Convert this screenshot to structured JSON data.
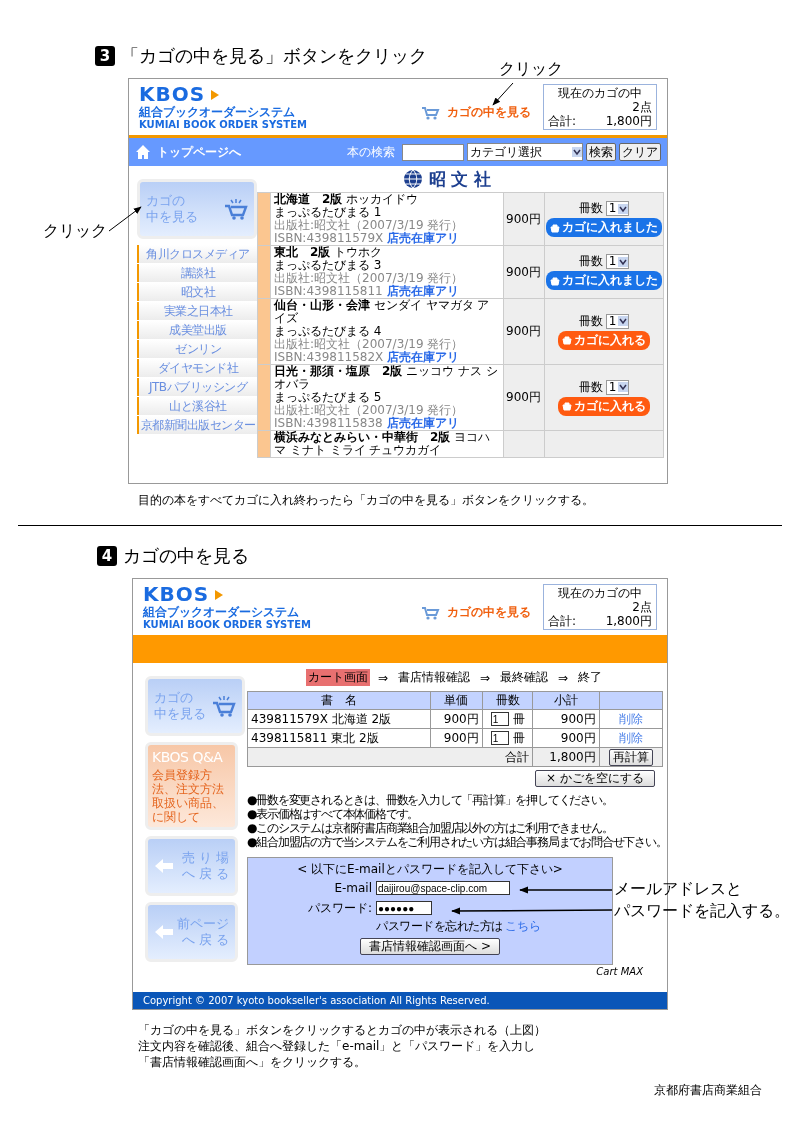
{
  "step3": {
    "number": "3",
    "title": "「カゴの中を見る」ボタンをクリック",
    "callouts": [
      "クリック",
      "クリック"
    ],
    "screen": {
      "header": {
        "logo": "KBOS",
        "logo_sub": "組合ブックオーダーシステム",
        "logo_en": "KUMIAI BOOK ORDER SYSTEM",
        "cart_link": "カゴの中を見る",
        "summary_title": "現在のカゴの中",
        "count": "2点",
        "total_label": "合計:",
        "total": "1,800円"
      },
      "nav": {
        "home": "トップページへ",
        "search_label": "本の検索",
        "category": "カテゴリ選択",
        "search_button": "検索",
        "clear_button": "クリア"
      },
      "sidebar": {
        "cart_button": [
          "カゴの",
          "中を見る"
        ],
        "publishers": [
          "角川クロスメディア",
          "講談社",
          "昭文社",
          "実業之日本社",
          "成美堂出版",
          "ゼンリン",
          "ダイヤモンド社",
          "JTBパブリッシング",
          "山と溪谷社",
          "京都新聞出版センター"
        ]
      },
      "publisher_name": "昭 文 社",
      "books": [
        {
          "title": "北海道　2版",
          "reading": "ホッカイドウ",
          "series": "まっぷるたびまる 1",
          "publisher": "出版社:昭文社（2007/3/19 発行）",
          "isbn": "ISBN:439811579X",
          "stock": "店売在庫アリ",
          "price": "900円",
          "qty_label": "冊数",
          "qty": "1",
          "in_cart": true,
          "button": "カゴに入れました"
        },
        {
          "title": "東北　2版",
          "reading": "トウホク",
          "series": "まっぷるたびまる 3",
          "publisher": "出版社:昭文社（2007/3/19 発行）",
          "isbn": "ISBN:4398115811",
          "stock": "店売在庫アリ",
          "price": "900円",
          "qty_label": "冊数",
          "qty": "1",
          "in_cart": true,
          "button": "カゴに入れました"
        },
        {
          "title": "仙台・山形・会津",
          "reading": "センダイ ヤマガタ アイズ",
          "series": "まっぷるたびまる 4",
          "publisher": "出版社:昭文社（2007/3/19 発行）",
          "isbn": "ISBN:439811582X",
          "stock": "店売在庫アリ",
          "price": "900円",
          "qty_label": "冊数",
          "qty": "1",
          "in_cart": false,
          "button": "カゴに入れる"
        },
        {
          "title": "日光・那須・塩原　2版",
          "reading": "ニッコウ ナス シオバラ",
          "series": "まっぷるたびまる 5",
          "publisher": "出版社:昭文社（2007/3/19 発行）",
          "isbn": "ISBN:4398115838",
          "stock": "店売在庫アリ",
          "price": "900円",
          "qty_label": "冊数",
          "qty": "1",
          "in_cart": false,
          "button": "カゴに入れる"
        },
        {
          "title": "横浜みなとみらい・中華街　2版",
          "reading": "ヨコハマ ミナト ミライ チュウカガイ"
        }
      ]
    },
    "caption": "目的の本をすべてカゴに入れ終わったら「カゴの中を見る」ボタンをクリックする。"
  },
  "step4": {
    "number": "4",
    "title": "カゴの中を見る",
    "callout": [
      "メールアドレスと",
      "パスワードを記入する。"
    ],
    "screen": {
      "header": {
        "logo": "KBOS",
        "logo_sub": "組合ブックオーダーシステム",
        "logo_en": "KUMIAI BOOK ORDER SYSTEM",
        "cart_link": "カゴの中を見る",
        "summary_title": "現在のカゴの中",
        "count": "2点",
        "total_label": "合計:",
        "total": "1,800円"
      },
      "sidebar": [
        {
          "kind": "cart",
          "lines": [
            "カゴの",
            "中を見る"
          ]
        },
        {
          "kind": "qa",
          "title": "KBOS Q&A",
          "lines": [
            "会員登録方法、注文方法",
            "取扱い商品、に関して"
          ]
        },
        {
          "kind": "back",
          "lines": [
            "売 り 場",
            "へ 戻 る"
          ]
        },
        {
          "kind": "back",
          "lines": [
            "前ページ",
            "へ 戻 る"
          ]
        }
      ],
      "steps": [
        {
          "label": "カート画面",
          "selected": true,
          "arrow": "⇒"
        },
        {
          "label": "書店情報確認",
          "selected": false,
          "arrow": "⇒"
        },
        {
          "label": "最終確認",
          "selected": false,
          "arrow": "⇒"
        },
        {
          "label": "終了",
          "selected": false
        }
      ],
      "cart_table": {
        "columns": [
          "書　名",
          "単価",
          "冊数",
          "小計"
        ],
        "rows": [
          {
            "title": "439811579X 北海道 2版",
            "price": "900円",
            "qty": "1",
            "unit": "冊",
            "subtotal": "900円",
            "delete": "削除"
          },
          {
            "title": "4398115811 東北 2版",
            "price": "900円",
            "qty": "1",
            "unit": "冊",
            "subtotal": "900円",
            "delete": "削除"
          }
        ],
        "total_label": "合計",
        "total": "1,800円",
        "recalc": "再計算"
      },
      "clear_button": "× かごを空にする",
      "notes": [
        "●冊数を変更されるときは、冊数を入力して「再計算」を押してください。",
        "●表示価格はすべて本体価格です。",
        "●このシステムは京都府書店商業組合加盟店以外の方はご利用できません。",
        "●組合加盟店の方で当システムをご利用されたい方は組合事務局までお問合せ下さい。"
      ],
      "login": {
        "heading": "< 以下にE-mailとパスワードを記入して下さい>",
        "email_label": "E-mail",
        "email": "daijirou@space-clip.com",
        "password_label": "パスワード:",
        "password": "●●●●●●",
        "forgot": "パスワードを忘れた方は",
        "forgot_link": "こちら",
        "submit": "書店情報確認画面へ >"
      },
      "credit": "Cart MAX",
      "copyright": "Copyright © 2007 kyoto bookseller's association All Rights Reserved."
    },
    "caption": [
      "「カゴの中を見る」ボタンをクリックするとカゴの中が表示される（上図）",
      "注文内容を確認後、組合へ登録した「e-mail」と「パスワード」を入力し",
      "「書店情報確認画面へ」をクリックする。"
    ]
  },
  "footer": "京都府書店商業組合"
}
